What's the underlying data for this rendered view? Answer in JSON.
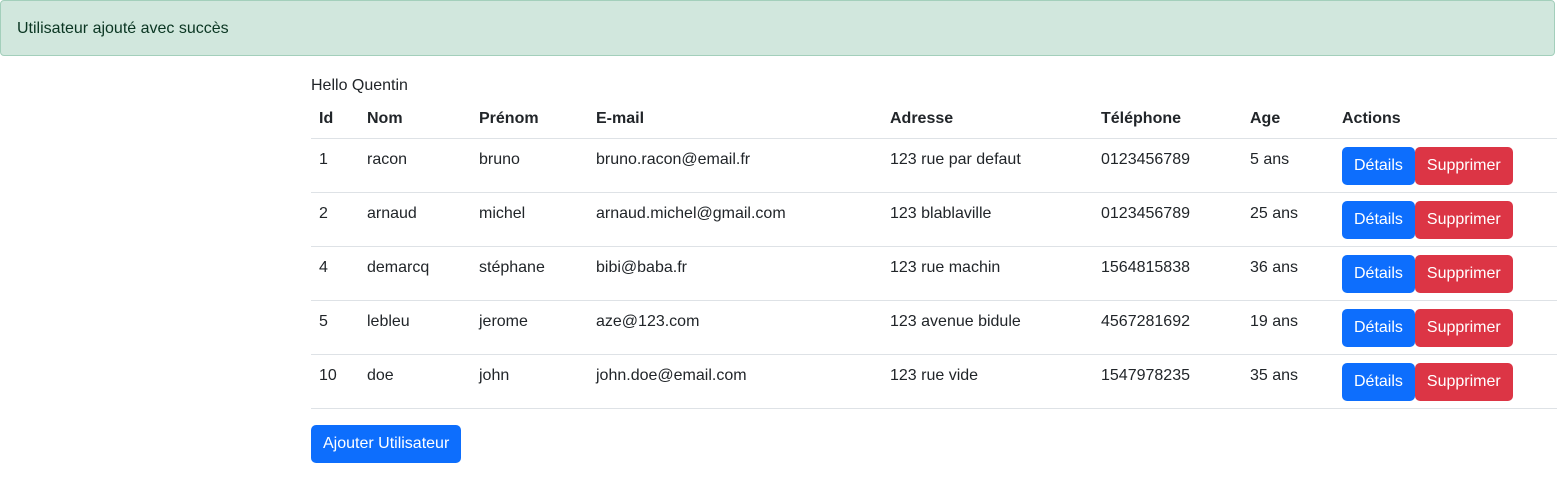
{
  "alert": {
    "message": "Utilisateur ajouté avec succès"
  },
  "greeting": "Hello Quentin",
  "table": {
    "headers": [
      "Id",
      "Nom",
      "Prénom",
      "E-mail",
      "Adresse",
      "Téléphone",
      "Age",
      "Actions"
    ],
    "rows": [
      {
        "id": "1",
        "nom": "racon",
        "prenom": "bruno",
        "email": "bruno.racon@email.fr",
        "adresse": "123 rue par defaut",
        "telephone": "0123456789",
        "age": "5 ans"
      },
      {
        "id": "2",
        "nom": "arnaud",
        "prenom": "michel",
        "email": "arnaud.michel@gmail.com",
        "adresse": "123 blablaville",
        "telephone": "0123456789",
        "age": "25 ans"
      },
      {
        "id": "4",
        "nom": "demarcq",
        "prenom": "stéphane",
        "email": "bibi@baba.fr",
        "adresse": "123 rue machin",
        "telephone": "1564815838",
        "age": "36 ans"
      },
      {
        "id": "5",
        "nom": "lebleu",
        "prenom": "jerome",
        "email": "aze@123.com",
        "adresse": "123 avenue bidule",
        "telephone": "4567281692",
        "age": "19 ans"
      },
      {
        "id": "10",
        "nom": "doe",
        "prenom": "john",
        "email": "john.doe@email.com",
        "adresse": "123 rue vide",
        "telephone": "1547978235",
        "age": "35 ans"
      }
    ],
    "details_label": "Détails",
    "delete_label": "Supprimer"
  },
  "add_user_label": "Ajouter Utilisateur",
  "colors": {
    "primary": "#0d6efd",
    "danger": "#dc3545",
    "success_bg": "#d1e7dd"
  }
}
